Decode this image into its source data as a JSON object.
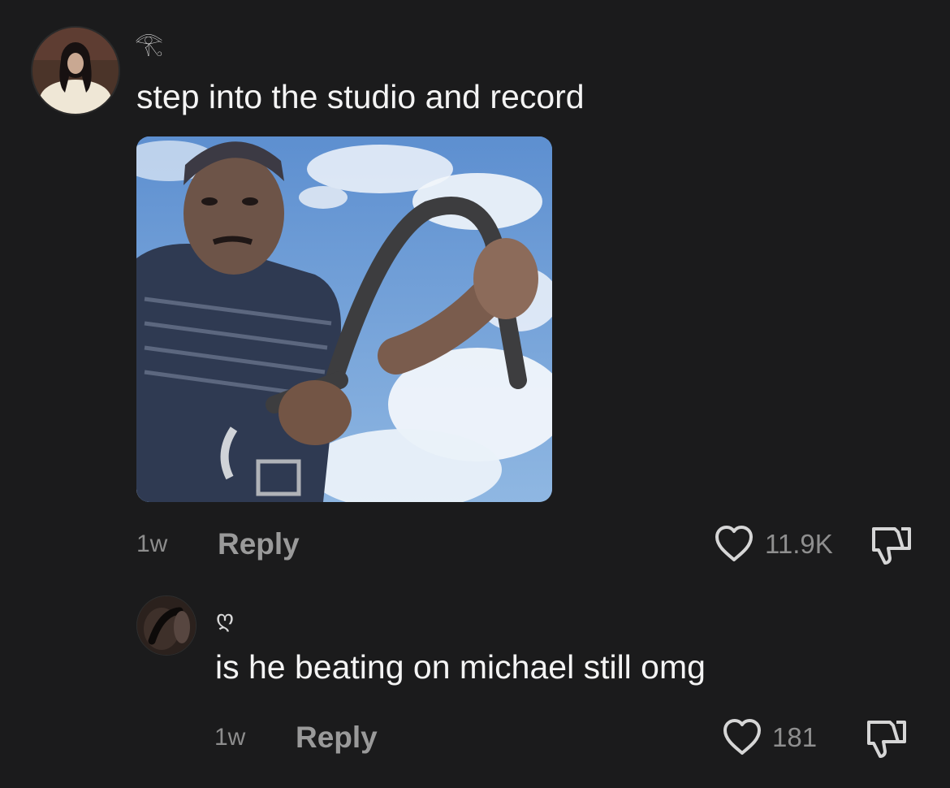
{
  "comments": [
    {
      "username_symbol": "𓂀",
      "text": "step into the studio and record",
      "time": "1w",
      "reply_label": "Reply",
      "like_count": "11.9K"
    },
    {
      "username_symbol": "ღ",
      "text": "is he beating on michael still omg",
      "time": "1w",
      "reply_label": "Reply",
      "like_count": "181"
    }
  ],
  "icons": {
    "like": "heart-outline-icon",
    "dislike": "thumbs-down-outline-icon"
  },
  "colors": {
    "background": "#1b1b1c",
    "text": "#f4f4f4",
    "meta": "#8d8d8d"
  }
}
